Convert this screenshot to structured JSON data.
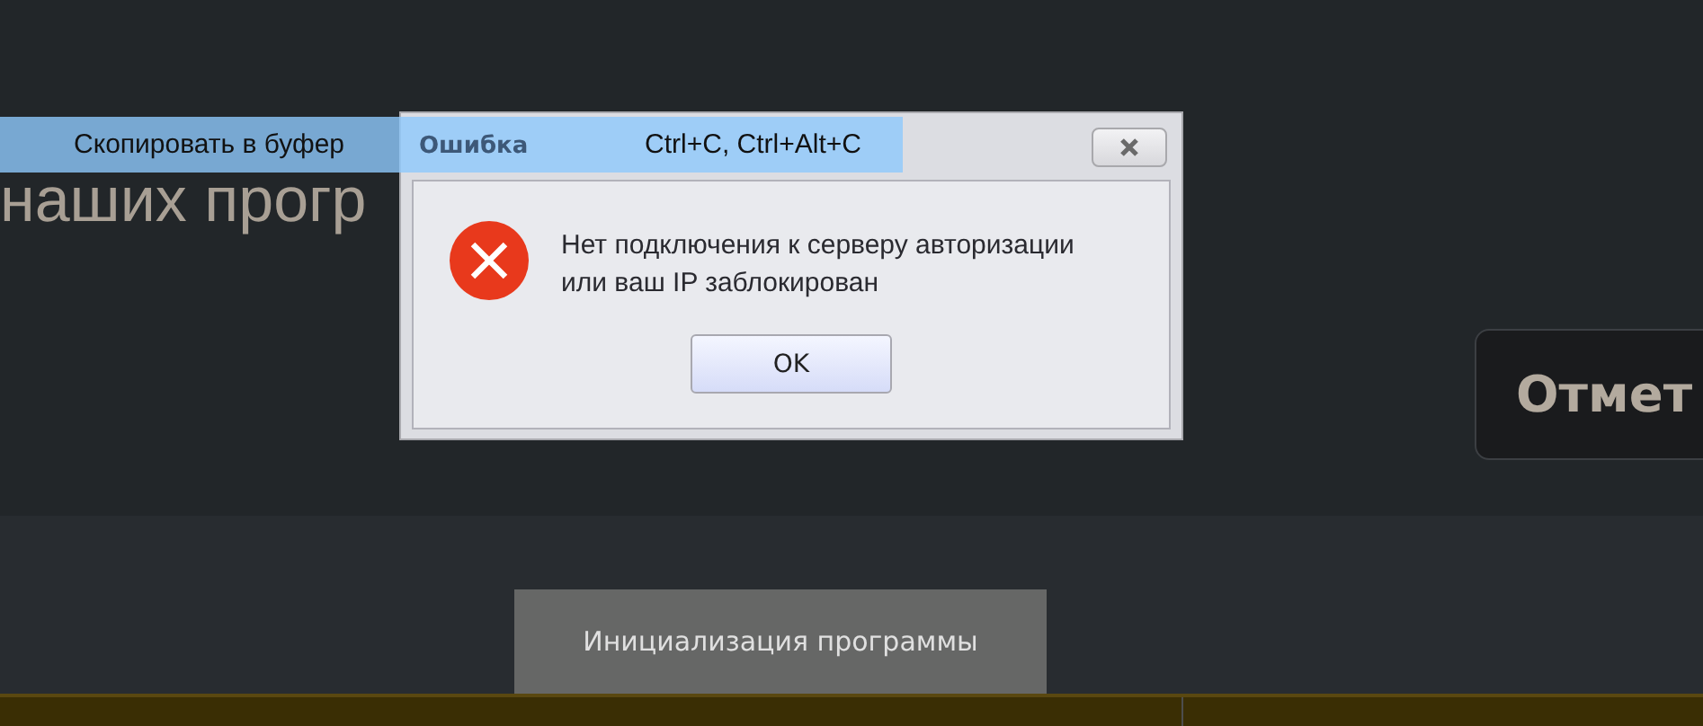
{
  "background": {
    "heading": "наших прогр",
    "mark_button": "Отмет",
    "status_label": "Инициализация программы"
  },
  "dialog": {
    "title": "Ошибка",
    "message": "Нет подключения к серверу авторизации\nили ваш IP заблокирован",
    "buttons": [
      {
        "label": "OK"
      }
    ]
  },
  "tooltip": {
    "label": "Скопировать в буфер",
    "shortcut": "Ctrl+C, Ctrl+Alt+C"
  }
}
